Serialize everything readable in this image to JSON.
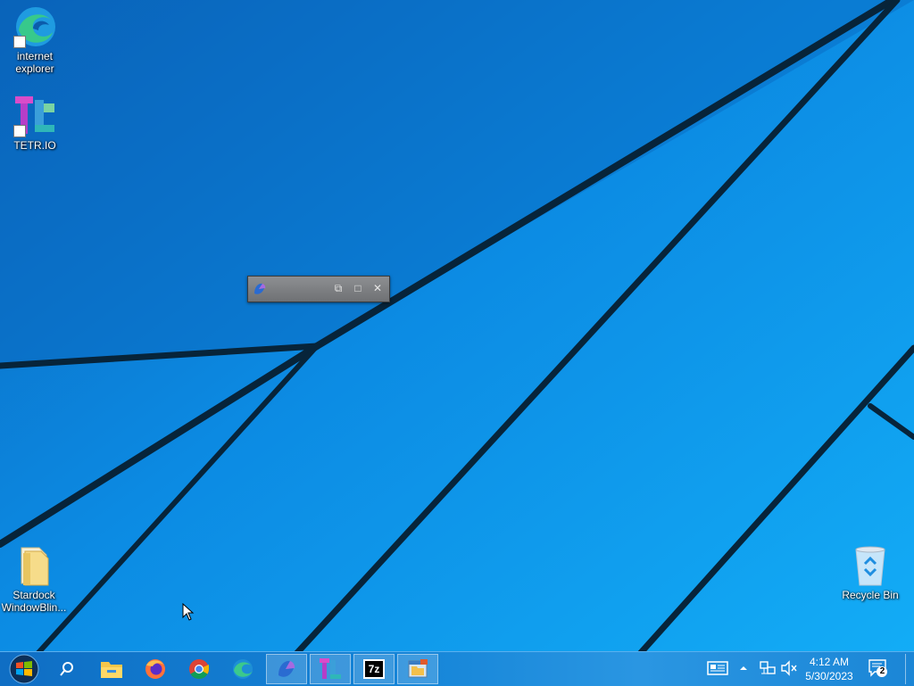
{
  "desktop": {
    "icons": [
      {
        "label": "internet explorer",
        "icon": "edge-icon"
      },
      {
        "label": "TETR.IO",
        "icon": "tetrio-icon"
      },
      {
        "label": "Stardock WindowBlin...",
        "icon": "folder-icon"
      },
      {
        "label": "Recycle Bin",
        "icon": "recycle-bin-icon"
      }
    ]
  },
  "mini_window": {
    "icon": "copilot-icon",
    "controls": [
      "restore-icon",
      "maximize-icon",
      "close-icon"
    ]
  },
  "taskbar": {
    "start": "windows-logo-icon",
    "search": "search-icon",
    "pinned": [
      {
        "name": "file-explorer",
        "icon": "folder-icon",
        "running": false
      },
      {
        "name": "firefox",
        "icon": "firefox-icon",
        "running": false
      },
      {
        "name": "chrome",
        "icon": "chrome-icon",
        "running": false
      },
      {
        "name": "edge",
        "icon": "edge-icon",
        "running": false
      },
      {
        "name": "copilot",
        "icon": "copilot-icon",
        "running": true
      },
      {
        "name": "tetrio",
        "icon": "tetrio-icon",
        "running": true
      },
      {
        "name": "7zip",
        "icon": "7zip-icon",
        "label": "7z",
        "running": true
      },
      {
        "name": "explorer-window",
        "icon": "explorer-window-icon",
        "running": true
      }
    ],
    "tray": {
      "news_icon": "news-icon",
      "chevron": "chevron-up-icon",
      "network_icon": "network-icon",
      "volume_icon": "volume-muted-icon",
      "time": "4:12 AM",
      "date": "5/30/2023",
      "notification_count": "2"
    }
  }
}
